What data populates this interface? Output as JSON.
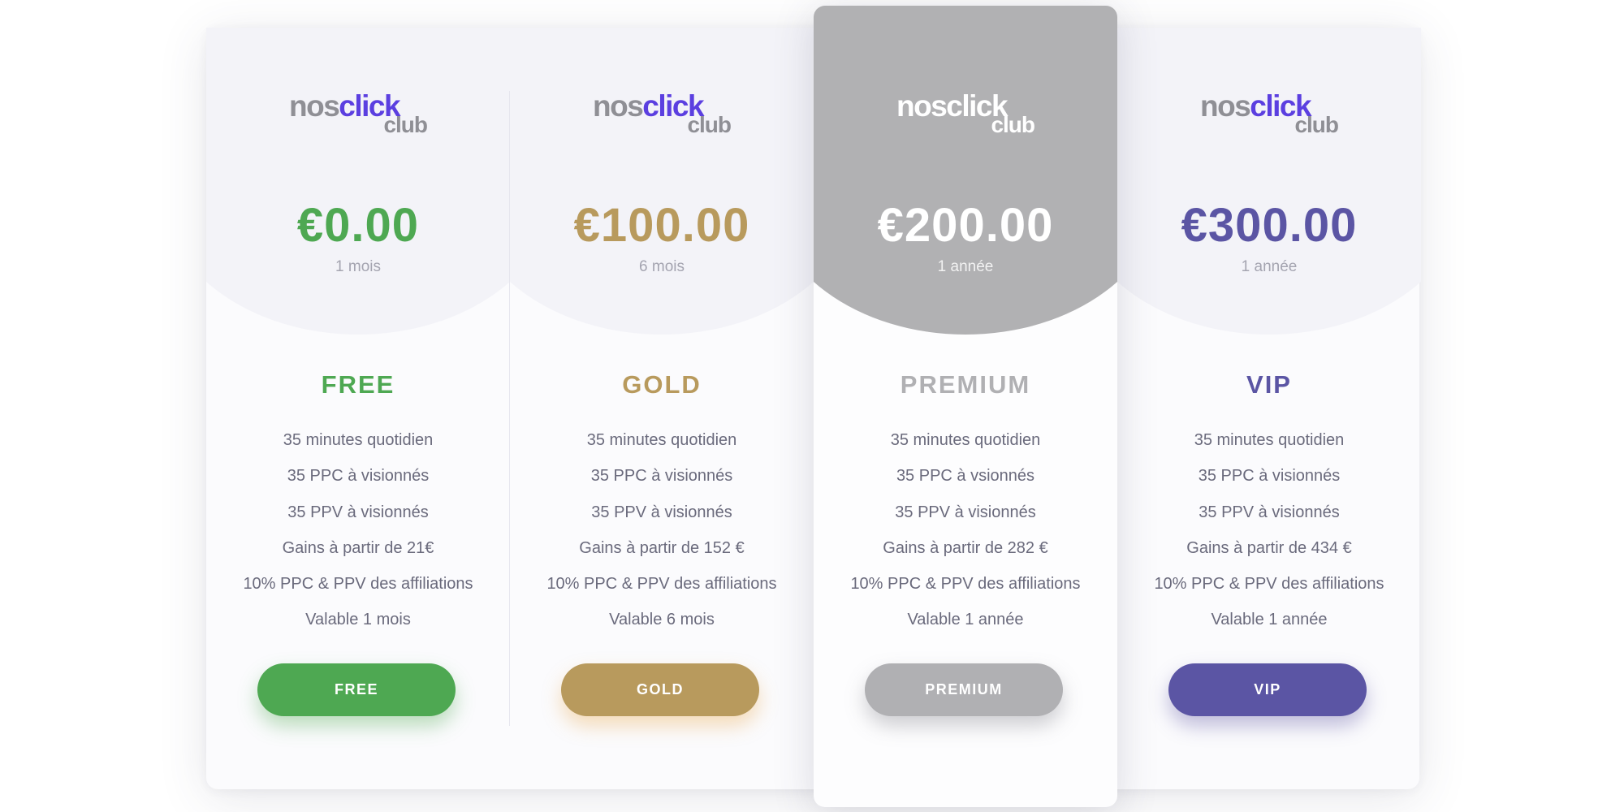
{
  "logo": {
    "nos": "nos",
    "click": "click",
    "club": "club"
  },
  "colors": {
    "free": "#4ea852",
    "gold": "#b89a5d",
    "premium": "#b0b0b3",
    "vip": "#5b55a4",
    "logo_accent": "#5b3fe0"
  },
  "plans": [
    {
      "key": "free",
      "price": "€0.00",
      "duration": "1 mois",
      "name": "FREE",
      "features": [
        "35 minutes quotidien",
        "35 PPC à visionnés",
        "35 PPV à visionnés",
        "Gains à partir de 21€",
        "10% PPC & PPV des affiliations",
        "Valable 1 mois"
      ],
      "button_label": "FREE"
    },
    {
      "key": "gold",
      "price": "€100.00",
      "duration": "6 mois",
      "name": "GOLD",
      "features": [
        "35 minutes quotidien",
        "35 PPC à visionnés",
        "35 PPV à visionnés",
        "Gains à partir de 152 €",
        "10% PPC & PPV des affiliations",
        "Valable 6 mois"
      ],
      "button_label": "GOLD"
    },
    {
      "key": "premium",
      "price": "€200.00",
      "duration": "1 année",
      "name": "PREMIUM",
      "features": [
        "35 minutes quotidien",
        "35 PPC à vsionnés",
        "35 PPV à visionnés",
        "Gains à partir de 282 €",
        "10% PPC & PPV des affiliations",
        "Valable 1 année"
      ],
      "button_label": "PREMIUM"
    },
    {
      "key": "vip",
      "price": "€300.00",
      "duration": "1 année",
      "name": "VIP",
      "features": [
        "35 minutes quotidien",
        "35 PPC à visionnés",
        "35 PPV à visionnés",
        "Gains à partir de 434 €",
        "10% PPC & PPV des affiliations",
        "Valable 1 année"
      ],
      "button_label": "VIP"
    }
  ]
}
